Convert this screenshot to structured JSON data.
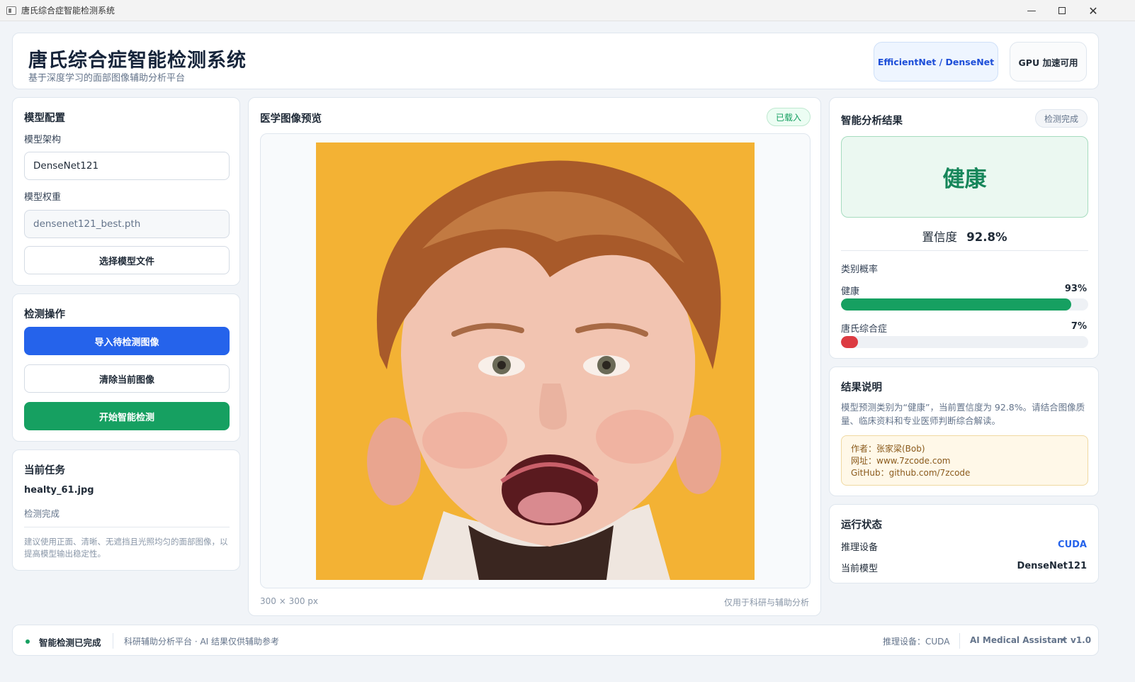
{
  "window": {
    "title": "唐氏综合症智能检测系统",
    "minimize_icon": "minimize-icon",
    "maximize_icon": "maximize-icon",
    "close_icon": "close-icon"
  },
  "header": {
    "title": "唐氏综合症智能检测系统",
    "subtitle": "基于深度学习的面部图像辅助分析平台",
    "badge_models": "EfficientNet / DenseNet",
    "badge_gpu": "GPU 加速可用"
  },
  "model_config": {
    "section_title": "模型配置",
    "arch_label": "模型架构",
    "arch_value": "DenseNet121",
    "weights_label": "模型权重",
    "weights_value": "densenet121_best.pth",
    "select_button": "选择模型文件"
  },
  "detect_ops": {
    "section_title": "检测操作",
    "import_button": "导入待检测图像",
    "clear_button": "清除当前图像",
    "start_button": "开始智能检测"
  },
  "current_task": {
    "section_title": "当前任务",
    "filename": "healty_61.jpg",
    "status": "检测完成",
    "tip": "建议使用正面、清晰、无遮挡且光照均匀的面部图像，以提高模型输出稳定性。"
  },
  "preview": {
    "section_title": "医学图像预览",
    "badge": "已载入",
    "image_size": "300 × 300 px",
    "disclaimer": "仅用于科研与辅助分析"
  },
  "analysis": {
    "section_title": "智能分析结果",
    "badge": "检测完成",
    "result_label": "健康",
    "confidence_label": "置信度",
    "confidence_value": "92.8%",
    "prob_title": "类别概率",
    "classes": [
      {
        "name": "健康",
        "percent_text": "93%",
        "fraction": 0.93,
        "color": "#16a061"
      },
      {
        "name": "唐氏综合症",
        "percent_text": "7%",
        "fraction": 0.07,
        "color": "#dc3b42"
      }
    ]
  },
  "explanation": {
    "section_title": "结果说明",
    "text": "模型预测类别为“健康”，当前置信度为 92.8%。请结合图像质量、临床资料和专业医师判断综合解读。",
    "author_line": "作者：张家梁(Bob)",
    "site_line": "网址：www.7zcode.com",
    "github_line": "GitHub：github.com/7zcode"
  },
  "runtime": {
    "section_title": "运行状态",
    "device_key": "推理设备",
    "device_value": "CUDA",
    "model_key": "当前模型",
    "model_value": "DenseNet121"
  },
  "statusbar": {
    "status": "智能检测已完成",
    "note": "科研辅助分析平台 · AI 结果仅供辅助参考",
    "device": "推理设备：CUDA",
    "brand": "AI Medical Assistant",
    "version": "v1.0",
    "dot_color": "#16a061"
  },
  "colors": {
    "primary": "#2563eb",
    "success": "#16a061",
    "danger": "#dc3b42"
  }
}
